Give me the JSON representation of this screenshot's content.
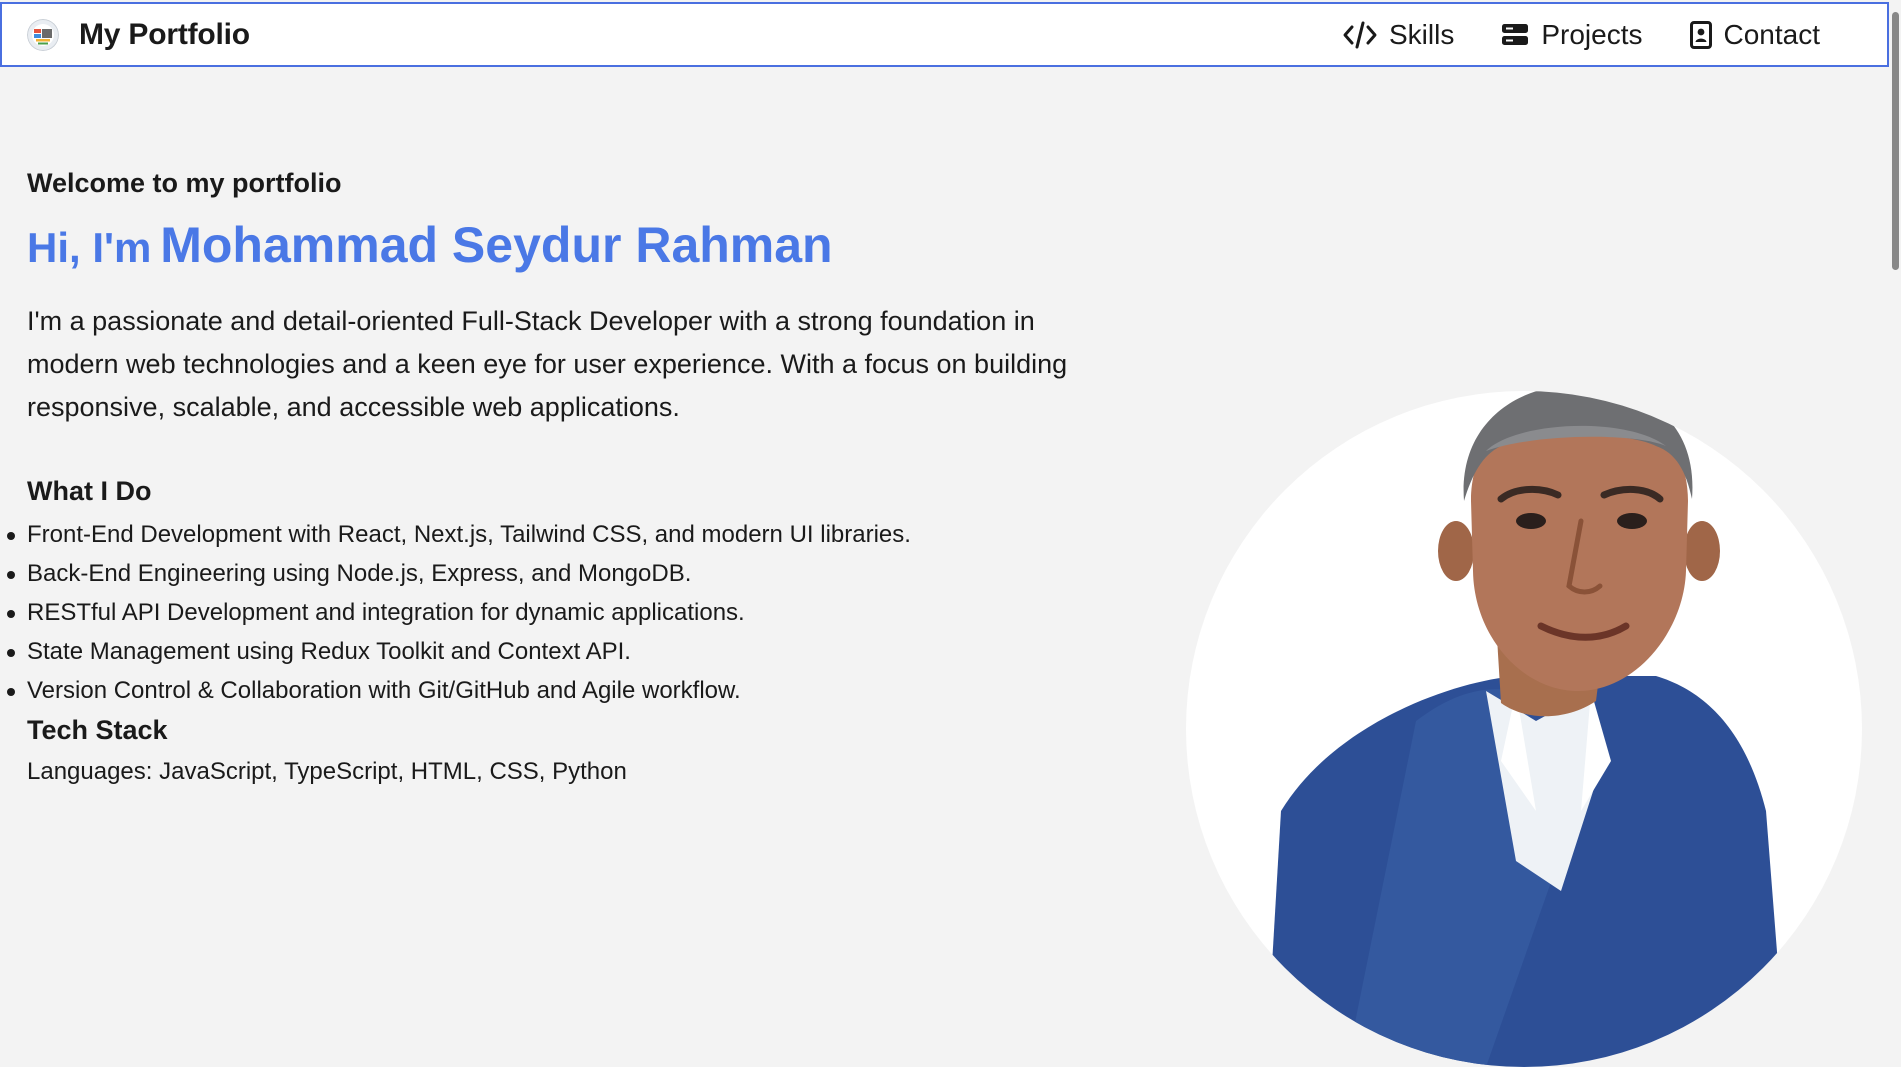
{
  "header": {
    "brand_title": "My Portfolio",
    "brand_logo": "portfolio-logo",
    "nav": [
      {
        "label": "Skills",
        "icon": "code-icon"
      },
      {
        "label": "Projects",
        "icon": "server-icon"
      },
      {
        "label": "Contact",
        "icon": "contact-card-icon"
      }
    ]
  },
  "hero": {
    "welcome": "Welcome to my portfolio",
    "greeting": "Hi, I'm",
    "name": "Mohammad Seydur Rahman",
    "intro": "I'm a passionate and detail-oriented Full-Stack Developer with a strong foundation in modern web technologies and a keen eye for user experience. With a focus on building responsive, scalable, and accessible web applications.",
    "what_i_do_heading": "What I Do",
    "services": [
      "Front-End Development with React, Next.js, Tailwind CSS, and modern UI libraries.",
      "Back-End Engineering using Node.js, Express, and MongoDB.",
      "RESTful API Development and integration for dynamic applications.",
      "State Management using Redux Toolkit and Context API.",
      "Version Control & Collaboration with Git/GitHub and Agile workflow."
    ],
    "tech_stack_heading": "Tech Stack",
    "tech_stack_line": "Languages: JavaScript, TypeScript, HTML, CSS, Python"
  },
  "colors": {
    "accent": "#4a78e6",
    "header_border": "#4a6fe0",
    "page_background": "#f3f3f3",
    "text": "#1a1a1a"
  }
}
